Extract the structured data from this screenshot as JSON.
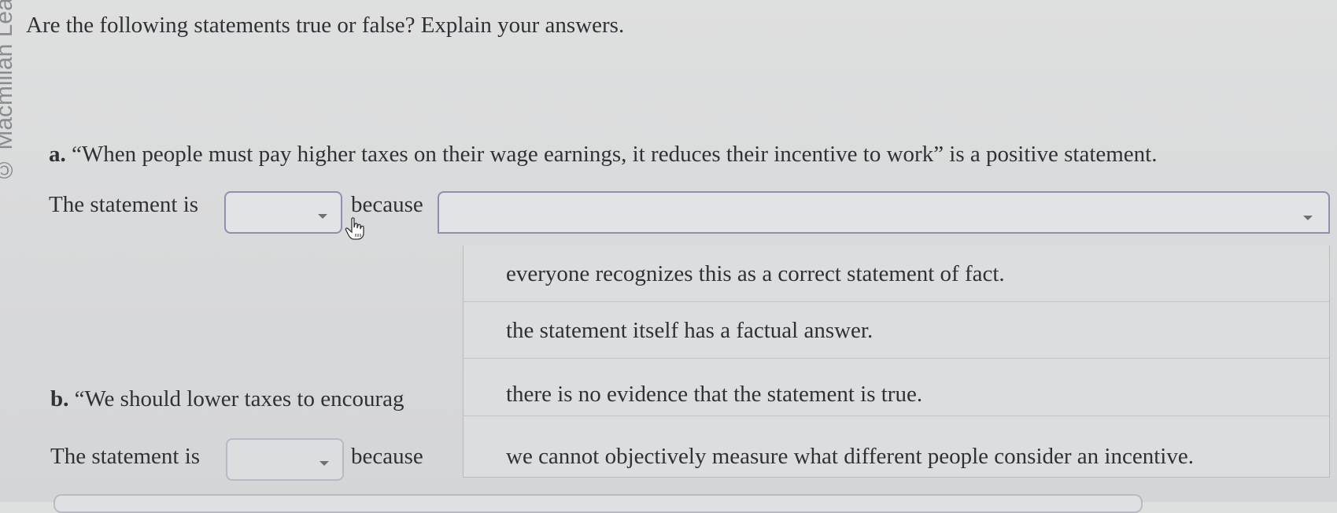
{
  "watermark": "© Macmillan Learning",
  "instructions": "Are the following statements true or false? Explain your answers.",
  "question_a": {
    "label": "a.",
    "text": "“When people must pay higher taxes on their wage earnings, it reduces their incentive to work” is a positive statement."
  },
  "question_b": {
    "label": "b.",
    "text": "“We should lower taxes to encourag"
  },
  "answer_a": {
    "prefix": "The statement is",
    "truth_value": "",
    "because_label": "because",
    "reason_value": "",
    "reason_options": [
      "everyone recognizes this as a correct statement of fact.",
      "the statement itself has a factual answer.",
      "there is no evidence that the statement is true.",
      "we cannot objectively measure what different people consider an incentive."
    ]
  },
  "answer_b": {
    "prefix": "The statement is",
    "truth_value": "",
    "because_label": "because"
  },
  "icons": {
    "cursor": "hand-pointer-icon",
    "caret": "chevron-down-icon"
  }
}
